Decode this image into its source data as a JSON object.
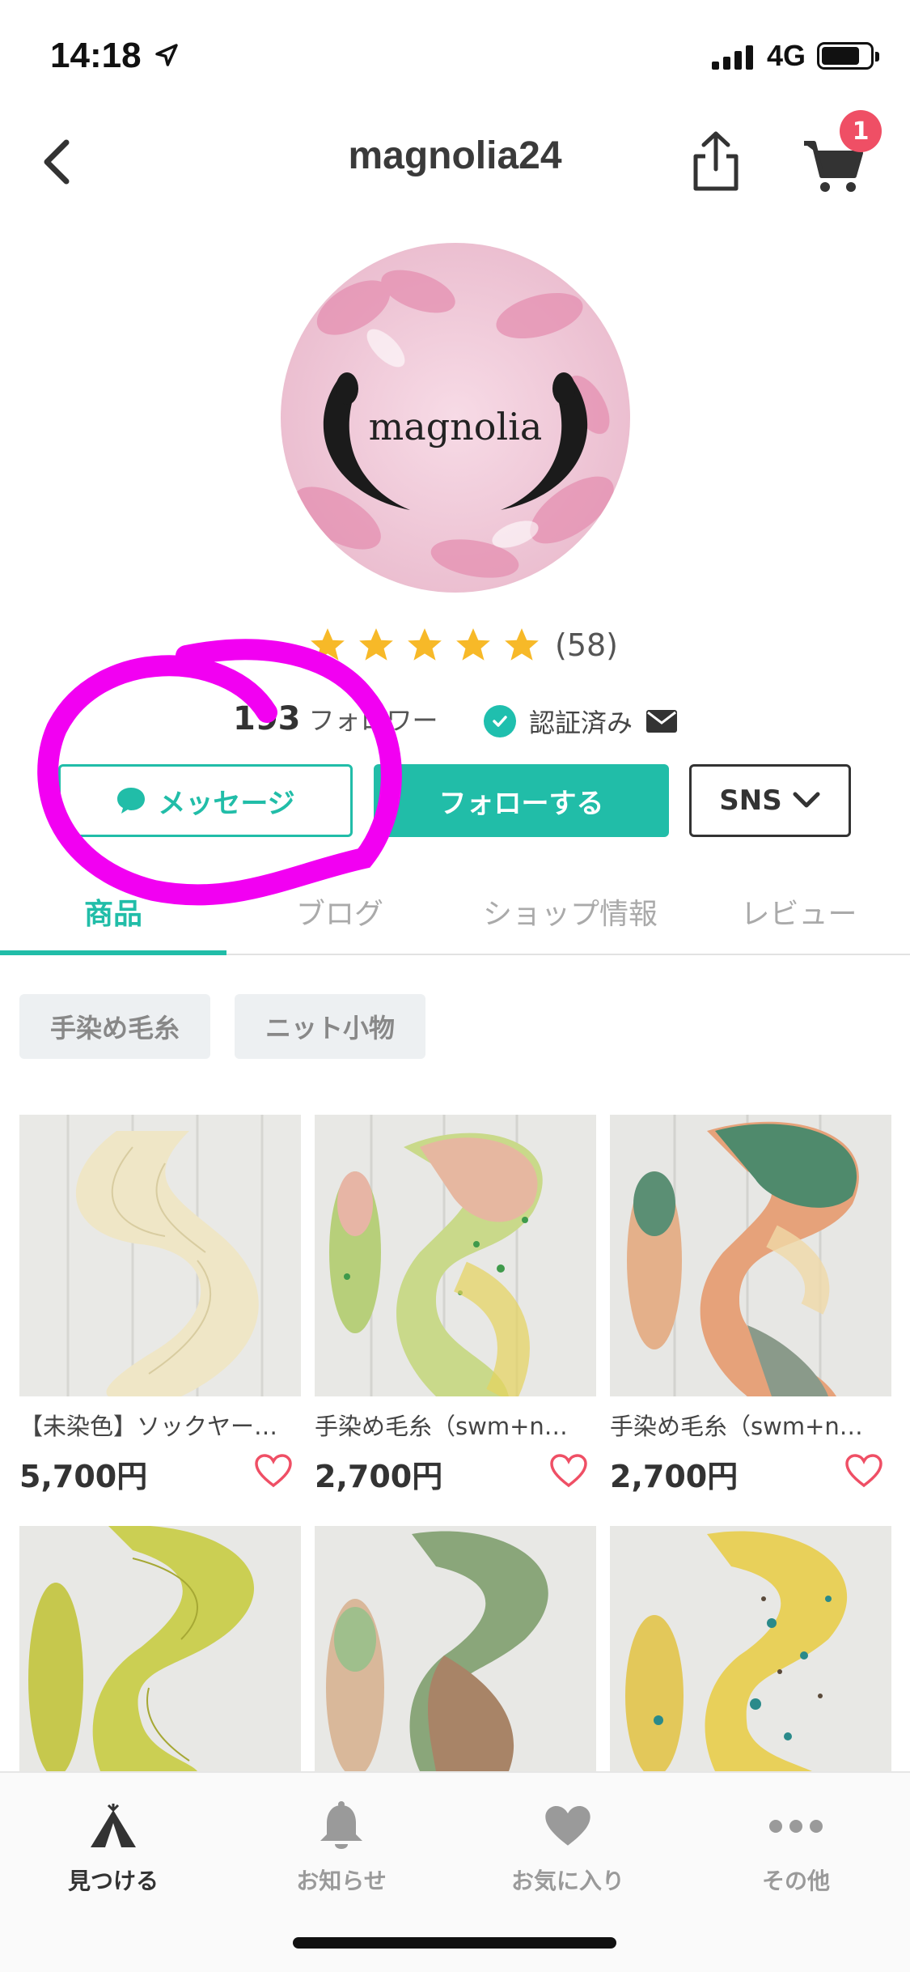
{
  "status_bar": {
    "time": "14:18",
    "network": "4G"
  },
  "nav": {
    "title": "magnolia24",
    "cart_badge": "1"
  },
  "profile": {
    "avatar_text": "magnolia",
    "rating_count": "(58)",
    "stars": 5,
    "followers_count": "193",
    "followers_label": "フォロワー",
    "verified_label": "認証済み"
  },
  "actions": {
    "message_label": "メッセージ",
    "follow_label": "フォローする",
    "sns_label": "SNS"
  },
  "tabs": [
    {
      "label": "商品"
    },
    {
      "label": "ブログ"
    },
    {
      "label": "ショップ情報"
    },
    {
      "label": "レビュー"
    }
  ],
  "categories": [
    {
      "label": "手染め毛糸"
    },
    {
      "label": "ニット小物"
    }
  ],
  "products": [
    {
      "name": "【未染色】ソックヤー…",
      "price": "5,700円"
    },
    {
      "name": "手染め毛糸（swm+n…",
      "price": "2,700円"
    },
    {
      "name": "手染め毛糸（swm+n…",
      "price": "2,700円"
    }
  ],
  "bottom_nav": [
    {
      "label": "見つける"
    },
    {
      "label": "お知らせ"
    },
    {
      "label": "お気に入り"
    },
    {
      "label": "その他"
    }
  ],
  "colors": {
    "accent": "#21bda8",
    "badge": "#ef4f65",
    "annotation": "#f200f2",
    "star": "#f7b928"
  }
}
